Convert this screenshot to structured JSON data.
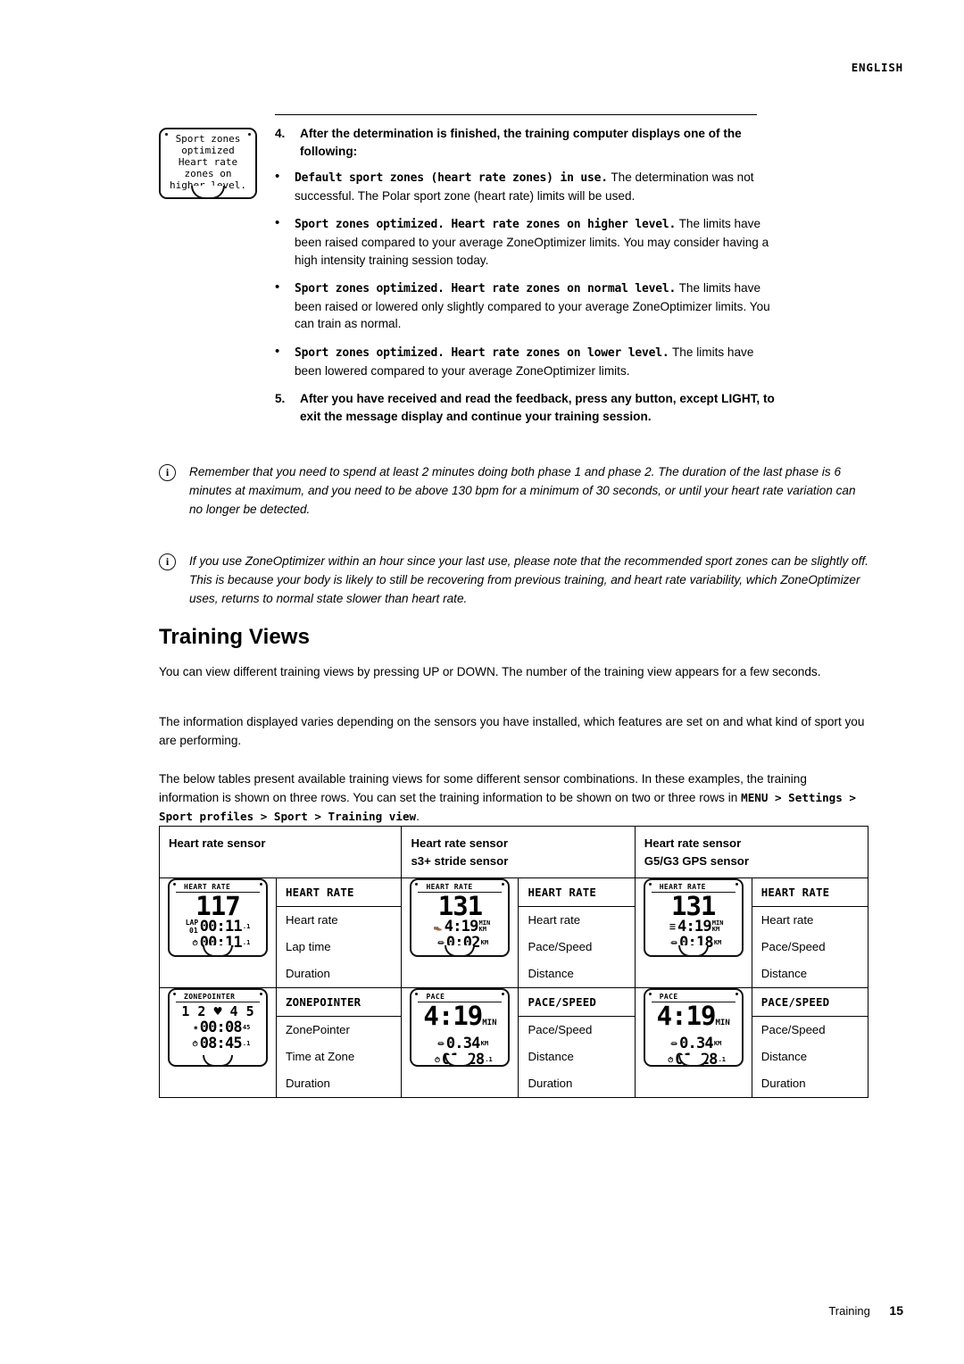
{
  "header": {
    "language": "ENGLISH"
  },
  "device_illustration_step4": {
    "lines": [
      "Sport zones",
      "optimized",
      "Heart rate",
      "zones on",
      "higher level."
    ]
  },
  "steps": [
    {
      "number": "4.",
      "text": "After the determination is finished, the training computer displays one of the following:"
    },
    {
      "number": "5.",
      "text": "After you have received and read the feedback, press any button, except LIGHT, to exit the message display and continue your training session."
    }
  ],
  "bullets": [
    {
      "lead": "Default sport zones (heart rate zones) in use.",
      "rest": " The determination was not successful. The Polar sport zone (heart rate) limits will be used."
    },
    {
      "lead": "Sport zones optimized. Heart rate zones on higher level.",
      "rest": " The limits have been raised compared to your average ZoneOptimizer limits. You may consider having a high intensity training session today."
    },
    {
      "lead": "Sport zones optimized. Heart rate zones on normal level.",
      "rest": " The limits have been raised or lowered only slightly compared to your average ZoneOptimizer limits. You can train as normal."
    },
    {
      "lead": "Sport zones optimized. Heart rate zones on lower level.",
      "rest": " The limits have been lowered compared to your average ZoneOptimizer limits."
    }
  ],
  "notes": [
    {
      "icon": "info-icon",
      "text": "Remember that you need to spend at least 2 minutes doing both phase 1 and phase 2. The duration of the last phase is 6 minutes at maximum, and you need to be above 130 bpm for a minimum of 30 seconds, or until your heart rate variation can no longer be detected."
    },
    {
      "icon": "info-icon",
      "text": "If you use ZoneOptimizer within an hour since your last use, please note that the recommended sport zones can be slightly off. This is because your body is likely to still be recovering from previous training, and heart rate variability, which ZoneOptimizer uses, returns to normal state slower than heart rate."
    }
  ],
  "section": {
    "title": "Training Views",
    "paragraphs": [
      "You can view different training views by pressing UP or DOWN. The number of the training view appears for a few seconds.",
      "The information displayed varies depending on the sensors you have installed, which features are set on and what kind of sport you are performing."
    ],
    "para3_before": "The below tables present available training views for some different sensor combinations. In these examples, the training information is shown on three rows. You can set the training information to be shown on two or three rows in ",
    "para3_path": "MENU > Settings > Sport profiles > Sport > Training view",
    "para3_after": "."
  },
  "table": {
    "headers": [
      {
        "title": "Heart rate sensor",
        "sub": ""
      },
      {
        "title": "Heart rate sensor",
        "sub": "s3+ stride sensor"
      },
      {
        "title": "Heart rate sensor",
        "sub": "G5/G3 GPS sensor"
      }
    ],
    "rows": [
      {
        "devices": [
          {
            "top_label": "HEART RATE",
            "big": "117",
            "line2": {
              "icon": "LAP",
              "icon2": "01",
              "value": "00:11",
              "small": ".1"
            },
            "line3": {
              "icon": "stopwatch-icon",
              "value": "00:11",
              "small": ".1"
            }
          },
          {
            "top_label": "HEART RATE",
            "big": "131",
            "line2": {
              "icon": "shoe-icon",
              "value": "4:19",
              "unit_top": "MIN",
              "unit_bot": "KM"
            },
            "line3": {
              "icon": "distance-icon",
              "value": "0:02",
              "unit_top": "",
              "unit_bot": "KM"
            }
          },
          {
            "top_label": "HEART RATE",
            "big": "131",
            "line2": {
              "icon": "gps-icon",
              "value": "4:19",
              "unit_top": "MIN",
              "unit_bot": "KM"
            },
            "line3": {
              "icon": "distance-icon",
              "value": "0:18",
              "unit_top": "",
              "unit_bot": "KM"
            }
          }
        ],
        "labels": [
          [
            "HEART RATE",
            "Heart rate",
            "Lap time",
            "Duration"
          ],
          [
            "HEART RATE",
            "Heart rate",
            "Pace/Speed",
            "Distance"
          ],
          [
            "HEART RATE",
            "Heart rate",
            "Pace/Speed",
            "Distance"
          ]
        ]
      },
      {
        "devices": [
          {
            "top_label": "ZONEPOINTER",
            "big": "1 2 ♥ 4 5",
            "line2": {
              "icon": "zone-icon",
              "value": "00:08",
              "small": "45"
            },
            "line3": {
              "icon": "stopwatch-icon",
              "value": "08:45",
              "small": ".1"
            }
          },
          {
            "top_label": "PACE",
            "big": "4:19",
            "line2": {
              "icon": "distance-icon",
              "value": "0.34",
              "unit_bot": "KM"
            },
            "line3": {
              "icon": "stopwatch-icon",
              "value": "01:28",
              "small": ".1"
            }
          },
          {
            "top_label": "PACE",
            "big": "4:19",
            "line2": {
              "icon": "distance-icon",
              "value": "0.34",
              "unit_bot": "KM"
            },
            "line3": {
              "icon": "stopwatch-icon",
              "value": "01:28",
              "small": ".1"
            }
          }
        ],
        "labels": [
          [
            "ZONEPOINTER",
            "ZonePointer",
            "Time at Zone",
            "Duration"
          ],
          [
            "PACE/SPEED",
            "Pace/Speed",
            "Distance",
            "Duration"
          ],
          [
            "PACE/SPEED",
            "Pace/Speed",
            "Distance",
            "Duration"
          ]
        ]
      }
    ]
  },
  "footer": {
    "label": "Training",
    "page": "15"
  }
}
